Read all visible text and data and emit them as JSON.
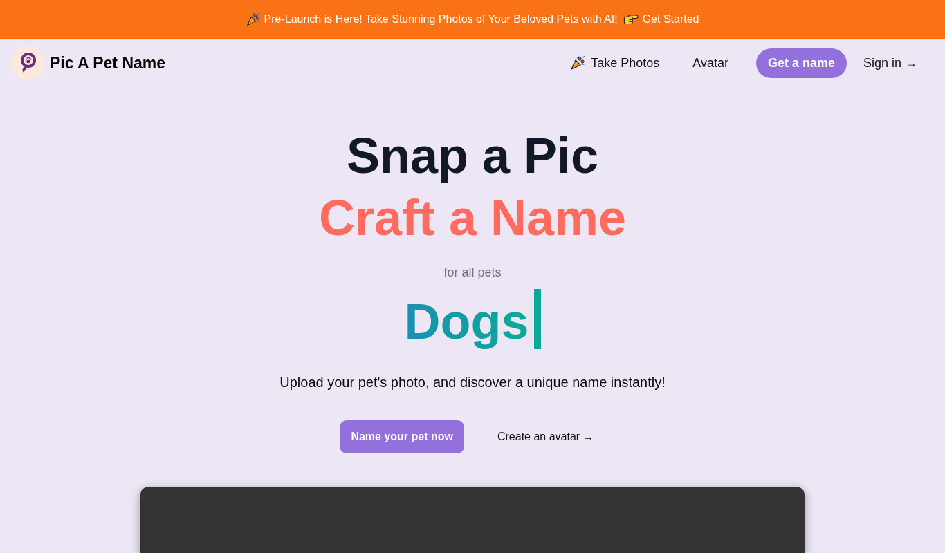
{
  "announcement_bar": {
    "message": "Pre-Launch is Here! Take Stunning Photos of Your Beloved Pets with AI!",
    "link": "Get Started"
  },
  "header": {
    "brand": "Pic A Pet Name",
    "nav": [
      {
        "label": "Take Photos",
        "kind": "icon-link"
      },
      {
        "label": "Avatar",
        "kind": "link"
      },
      {
        "label": "Get a name",
        "kind": "pill"
      },
      {
        "label": "Sign in →",
        "kind": "link"
      }
    ]
  },
  "hero": {
    "title_lines": [
      {
        "text": "Snap a Pic",
        "color": "#111827"
      },
      {
        "text": "Craft a Name",
        "color": "#ff6b5e"
      }
    ],
    "tagline": "for all pets",
    "typed_word": "Dogs",
    "description": "Upload your pet's photo, and discover a unique name instantly!",
    "actions": [
      {
        "label": "Name your pet now",
        "kind": "primary"
      },
      {
        "label": "Create an avatar →",
        "kind": "link"
      }
    ]
  }
}
